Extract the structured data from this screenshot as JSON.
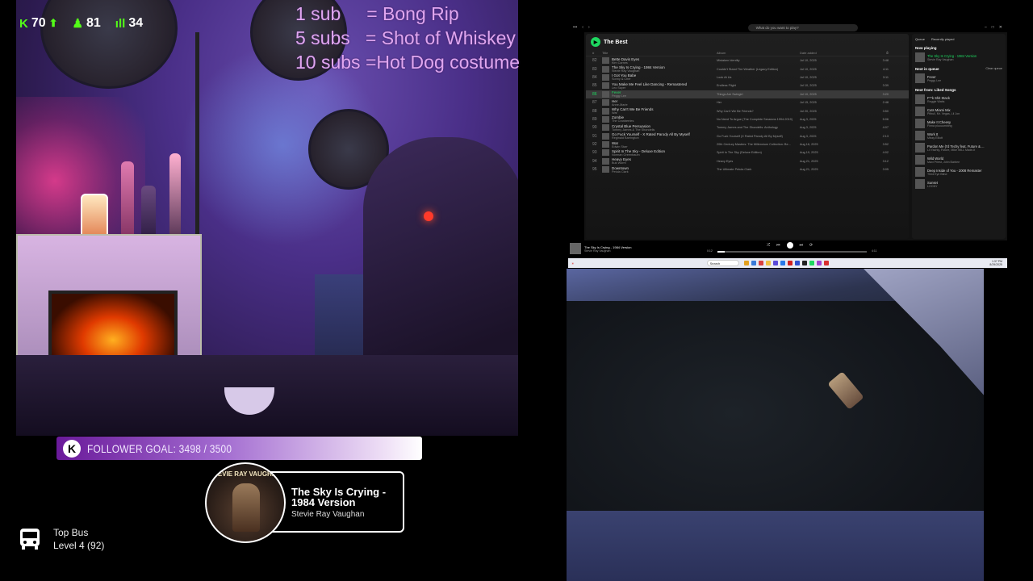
{
  "stats": {
    "followers": "70",
    "viewers": "81",
    "subs": "34"
  },
  "sub_goals": "1 sub     = Bong Rip\n5 subs   = Shot of Whiskey\n10 subs =Hot Dog costume",
  "follower_goal": {
    "label": "FOLLOWER GOAL: 3498 / 3500",
    "current": 3498,
    "target": 3500
  },
  "now_playing": {
    "title": "The Sky Is Crying - 1984 Version",
    "artist": "Stevie Ray Vaughan",
    "album_text": "STEVIE RAY VAUGHAN"
  },
  "top_bus": {
    "title": "Top Bus",
    "level": "Level 4  (92)"
  },
  "spotify": {
    "search_placeholder": "What do you want to play?",
    "playlist_title": "The Best",
    "headers": {
      "num": "#",
      "title": "Title",
      "album": "Album",
      "date": "Date added",
      "dur": "⏱"
    },
    "rows": [
      {
        "n": "82",
        "t": "Bette Davis Eyes",
        "a": "Kim Carnes",
        "al": "Mistaken Identity",
        "d": "Jul 10, 2025",
        "dur": "3:48"
      },
      {
        "n": "83",
        "t": "The Sky Is Crying - 1984 Version",
        "a": "Stevie Ray Vaughan",
        "al": "Couldn't Stand The Weather (Legacy Edition)",
        "d": "Jul 10, 2025",
        "dur": "4:11"
      },
      {
        "n": "84",
        "t": "I Got You Babe",
        "a": "Sonny & Cher",
        "al": "Look At Us",
        "d": "Jul 10, 2025",
        "dur": "3:11"
      },
      {
        "n": "85",
        "t": "You Make Me Feel Like Dancing - Remastered",
        "a": "Leo Sayer",
        "al": "Endless Flight",
        "d": "Jul 10, 2025",
        "dur": "3:39"
      },
      {
        "n": "86",
        "t": "Fever",
        "a": "Peggy Lee",
        "al": "Things Are Swingin'",
        "d": "Jul 10, 2025",
        "dur": "3:20"
      },
      {
        "n": "87",
        "t": "Her",
        "a": "Anne-Marie",
        "al": "Her",
        "d": "Jul 15, 2025",
        "dur": "2:48"
      },
      {
        "n": "88",
        "t": "Why Can't We Be Friends",
        "a": "War",
        "al": "Why Can't We Be Friends?",
        "d": "Jul 20, 2025",
        "dur": "3:50"
      },
      {
        "n": "89",
        "t": "Zombie",
        "a": "The Cranberries",
        "al": "No Need To Argue (The Complete Sessions 1994-2019)",
        "d": "Aug 3, 2025",
        "dur": "5:06"
      },
      {
        "n": "90",
        "t": "Crystal Blue Persuasion",
        "a": "Tommy James & The Shondells",
        "al": "Tommy James and The Shondells: Anthology",
        "d": "Aug 3, 2025",
        "dur": "4:07"
      },
      {
        "n": "91",
        "t": "Go Fuck Yourself - X Rated Parody All By Myself",
        "a": "Reginald Barrington",
        "al": "Go Fuck Yourself (X Rated Parody All By Myself)",
        "d": "Aug 3, 2025",
        "dur": "2:13"
      },
      {
        "n": "92",
        "t": "War",
        "a": "Edwin Starr",
        "al": "20th Century Masters: The Millennium Collection: Be...",
        "d": "Aug 16, 2025",
        "dur": "3:52"
      },
      {
        "n": "93",
        "t": "Spirit In The Sky - Deluxe Edition",
        "a": "Norman Greenbaum",
        "al": "Spirit In The Sky (Deluxe Edition)",
        "d": "Aug 19, 2025",
        "dur": "4:02"
      },
      {
        "n": "94",
        "t": "Heavy Eyes",
        "a": "Buk Worm",
        "al": "Heavy Eyes",
        "d": "Aug 21, 2025",
        "dur": "3:12"
      },
      {
        "n": "95",
        "t": "Downtown",
        "a": "Petula Clark",
        "al": "The Ultimate Petula Clark",
        "d": "Aug 21, 2025",
        "dur": "3:05"
      }
    ],
    "queue": {
      "tab1": "Queue",
      "tab2": "Recently played",
      "now_playing_h": "Now playing",
      "now": {
        "t": "The Sky Is Crying - 1984 Version",
        "a": "Stevie Ray Vaughan"
      },
      "next_h": "Next in queue",
      "clear": "Clear queue",
      "next": {
        "t": "Fever",
        "a": "Peggy Lee"
      },
      "liked_h": "Next from: Liked Songs",
      "liked": [
        {
          "t": "F**k Shit Stack",
          "a": "Reggie Watts"
        },
        {
          "t": "Cuts Miami Mix",
          "a": "Pitbull, Mr. Vegas, Lil Jon"
        },
        {
          "t": "Make It Cheesy",
          "a": "Finna pluuuumbing"
        },
        {
          "t": "Work It",
          "a": "Missy Elliott"
        },
        {
          "t": "Pardon Me (I'd Techy feat. Future & ...",
          "a": "Lil Yachty, Future, Mike WiLL Made-It"
        },
        {
          "t": "Wild World",
          "a": "Maxi Priest, John Barbee"
        },
        {
          "t": "Deep Inside of You - 2008 Remaster",
          "a": "Third Eye Blind"
        },
        {
          "t": "Sunset",
          "a": "LOONY"
        }
      ]
    },
    "player": {
      "t": "The Sky Is Crying - 1984 Version",
      "a": "Stevie Ray Vaughan",
      "elapsed": "0:12",
      "total": "4:11"
    },
    "progress_fraction": 0.05
  },
  "taskbar": {
    "search": "Search",
    "time": "1:37 PM",
    "date": "8/29/2025"
  },
  "colors": {
    "spotify_green": "#1ed760",
    "kick_green": "#53fc18",
    "sub_text": "#e0a6f0"
  }
}
